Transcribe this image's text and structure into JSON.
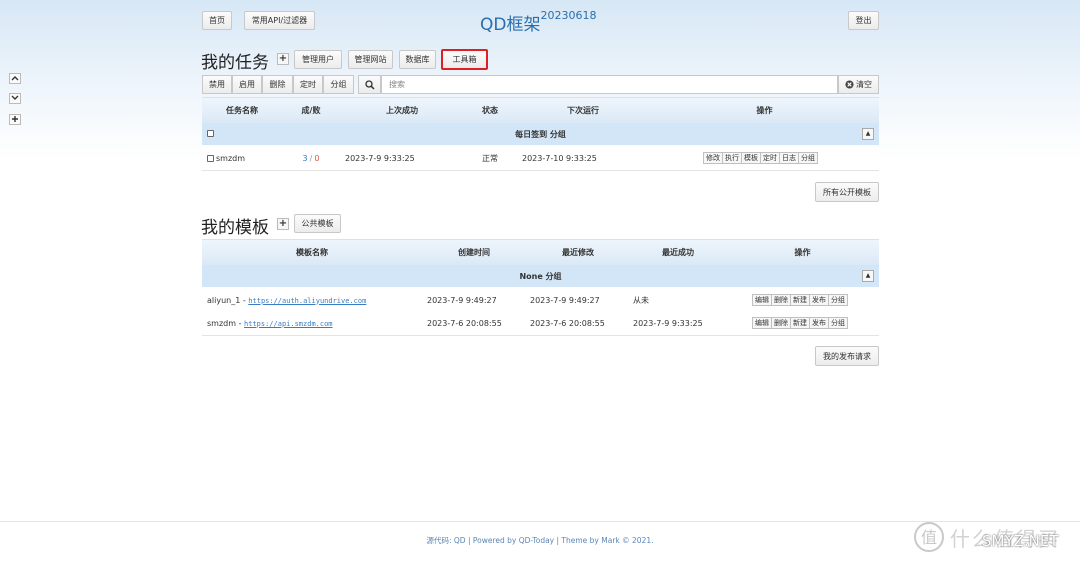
{
  "header": {
    "home_label": "首页",
    "api_filter_label": "常用API/过滤器",
    "title": "QD框架",
    "version": "20230618",
    "logout_label": "登出"
  },
  "side": {
    "up_icon": "chevron-up-icon",
    "down_icon": "chevron-down-icon",
    "add_icon": "plus-icon"
  },
  "tasks": {
    "heading": "我的任务",
    "add_label": "+",
    "manage_users": "管理用户",
    "manage_sites": "管理网站",
    "database": "数据库",
    "toolbox": "工具箱",
    "toolbar": {
      "disable": "禁用",
      "enable": "启用",
      "delete": "删除",
      "schedule": "定时",
      "group": "分组",
      "search_placeholder": "搜索",
      "clear": "清空"
    },
    "columns": [
      "任务名称",
      "成/败",
      "上次成功",
      "状态",
      "下次运行",
      "操作"
    ],
    "group_name": "每日签到 分组",
    "rows": [
      {
        "name": "smzdm",
        "success": "3",
        "slash": "/",
        "fail": "0",
        "last_success": "2023-7-9 9:33:25",
        "status": "正常",
        "next_run": "2023-7-10 9:33:25",
        "ops": [
          "修改",
          "执行",
          "模板",
          "定时",
          "日志",
          "分组"
        ]
      }
    ],
    "all_public_templates": "所有公开模板"
  },
  "templates": {
    "heading": "我的模板",
    "add_label": "+",
    "public_templates": "公共模板",
    "columns": [
      "模板名称",
      "创建时间",
      "最近修改",
      "最近成功",
      "操作"
    ],
    "group_name": "None 分组",
    "rows": [
      {
        "name": "aliyun_1",
        "dash": " - ",
        "url": "https://auth.aliyundrive.com",
        "created": "2023-7-9 9:49:27",
        "modified": "2023-7-9 9:49:27",
        "last_success": "从未",
        "ops": [
          "编辑",
          "删除",
          "新建",
          "发布",
          "分组"
        ]
      },
      {
        "name": "smzdm",
        "dash": " - ",
        "url": "https://api.smzdm.com",
        "created": "2023-7-6 20:08:55",
        "modified": "2023-7-6 20:08:55",
        "last_success": "2023-7-9 9:33:25",
        "ops": [
          "编辑",
          "删除",
          "新建",
          "发布",
          "分组"
        ]
      }
    ],
    "my_publish_requests": "我的发布请求"
  },
  "footer": {
    "source_label": "源代码: QD",
    "sep1": " | ",
    "powered": "Powered by QD-Today",
    "sep2": " | ",
    "theme": "Theme by Mark © 2021."
  },
  "watermark": {
    "text_cn": "什么值得买",
    "text_en": "SMYZ.NET"
  },
  "colors": {
    "accent": "#2a6fad",
    "highlight_border": "#e02020",
    "fail": "#d9534f",
    "success": "#3a7cc4"
  }
}
